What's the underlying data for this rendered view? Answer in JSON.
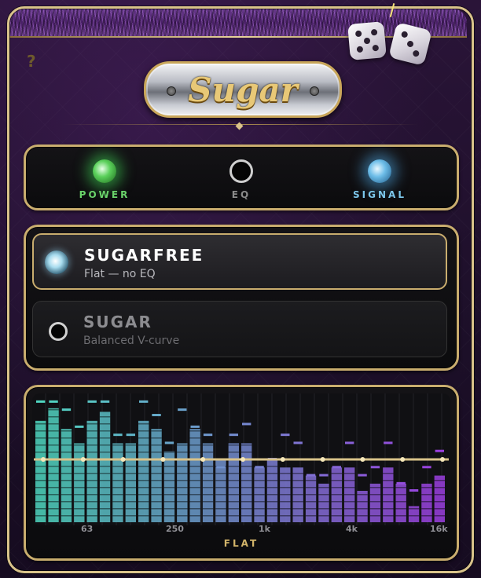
{
  "app": {
    "logo_text": "Sugar",
    "help_glyph": "?"
  },
  "indicators": [
    {
      "id": "power",
      "label": "POWER",
      "state": "on",
      "color": "#5ad05a"
    },
    {
      "id": "eq",
      "label": "EQ",
      "state": "off",
      "color": "#cfcfcf"
    },
    {
      "id": "signal",
      "label": "SIGNAL",
      "state": "on",
      "color": "#6dbde8"
    }
  ],
  "presets": [
    {
      "name": "SUGARFREE",
      "description": "Flat — no EQ",
      "selected": true
    },
    {
      "name": "SUGAR",
      "description": "Balanced V-curve",
      "selected": false
    }
  ],
  "eq": {
    "mode_label": "FLAT",
    "axis_labels": [
      "63",
      "250",
      "1k",
      "4k",
      "16k"
    ]
  },
  "chart_data": {
    "type": "bar",
    "title": "",
    "xlabel": "",
    "ylabel": "",
    "ylim": [
      0,
      14
    ],
    "values": [
      11.3,
      12.7,
      10.4,
      8.8,
      11.3,
      12.3,
      8.8,
      8.8,
      11.3,
      10.4,
      7.9,
      8.8,
      10.4,
      8.8,
      7.0,
      8.8,
      8.8,
      6.1,
      7.0,
      6.1,
      6.1,
      5.2,
      4.3,
      6.1,
      6.1,
      3.5,
      4.3,
      6.1,
      4.3,
      1.8,
      4.3,
      5.2
    ],
    "peaks": [
      13.4,
      13.4,
      12.5,
      10.6,
      13.4,
      13.4,
      9.7,
      9.7,
      13.4,
      11.9,
      8.8,
      12.5,
      10.6,
      9.7,
      6.1,
      9.7,
      10.9,
      6.1,
      7.0,
      9.7,
      8.8,
      5.2,
      5.2,
      6.1,
      8.8,
      5.2,
      6.1,
      8.8,
      4.3,
      3.5,
      6.1,
      7.9
    ],
    "flat_line": 7.0,
    "colors_start": "#4fd6c0",
    "colors_end": "#9b3fe0"
  }
}
